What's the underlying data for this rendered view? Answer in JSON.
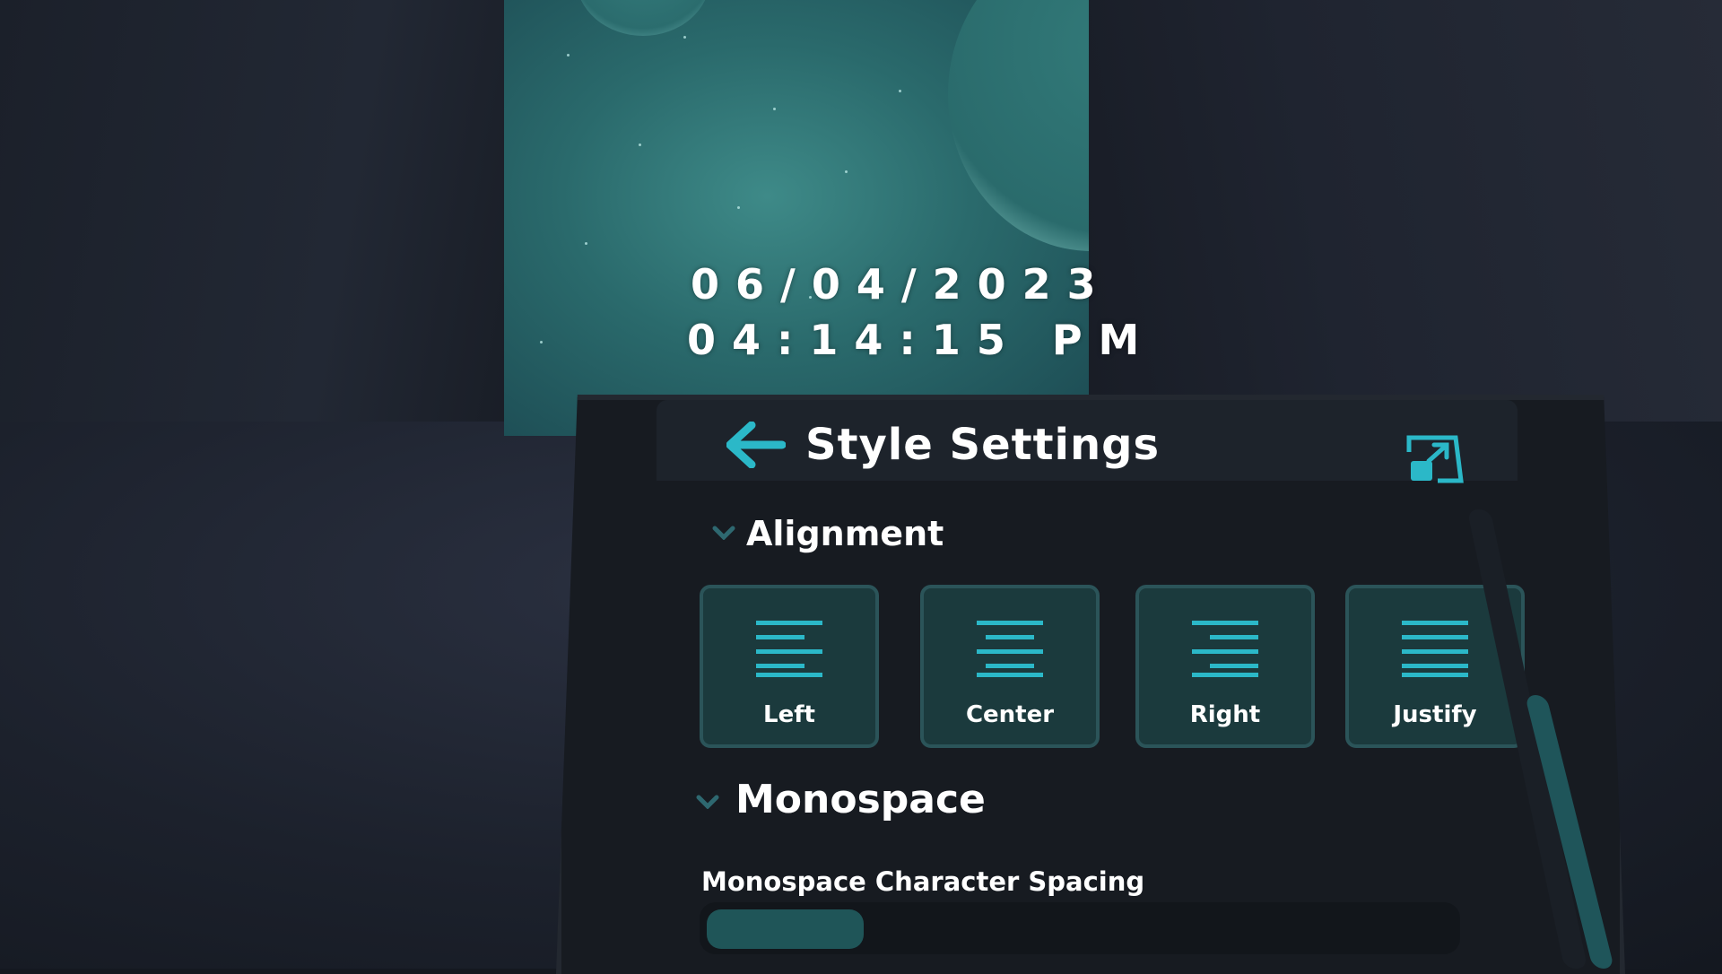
{
  "clock": {
    "date": "06/04/2023",
    "time": "04:14:15 PM"
  },
  "panel": {
    "title": "Style Settings",
    "back_icon": "arrow-left-icon",
    "popout_icon": "popout-window-icon"
  },
  "alignment": {
    "label": "Alignment",
    "buttons": [
      {
        "label": "Left",
        "icon": "align-left-icon"
      },
      {
        "label": "Center",
        "icon": "align-center-icon"
      },
      {
        "label": "Right",
        "icon": "align-right-icon"
      },
      {
        "label": "Justify",
        "icon": "align-justify-icon"
      }
    ]
  },
  "monospace": {
    "label": "Monospace",
    "spacing_label": "Monospace Character Spacing",
    "spacing_value_fraction": 0.21
  },
  "colors": {
    "accent": "#2bb8c8",
    "button_bg": "#1b3a3d",
    "panel_bg": "#171b21"
  }
}
